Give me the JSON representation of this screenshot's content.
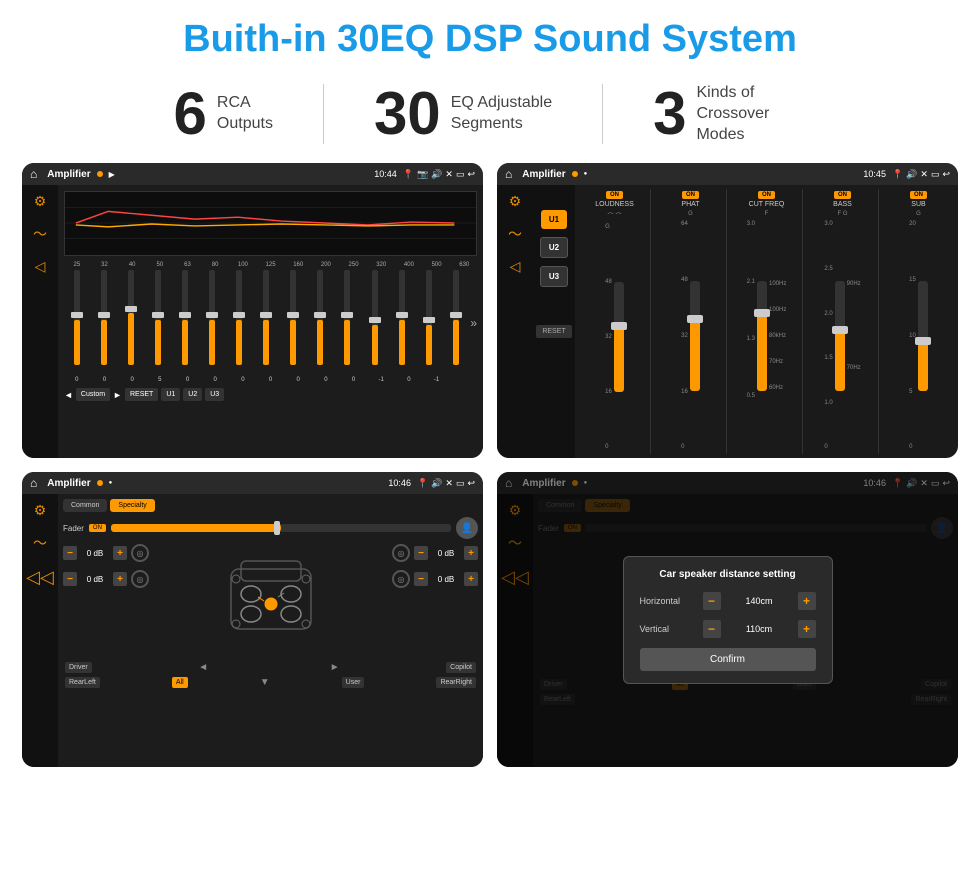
{
  "page": {
    "title": "Buith-in 30EQ DSP Sound System",
    "bg_color": "#ffffff"
  },
  "stats": [
    {
      "number": "6",
      "label": "RCA\nOutputs"
    },
    {
      "number": "30",
      "label": "EQ Adjustable\nSegments"
    },
    {
      "number": "3",
      "label": "Kinds of\nCrossover Modes"
    }
  ],
  "screens": [
    {
      "id": "eq-screen",
      "time": "10:44",
      "title": "Amplifier",
      "description": "EQ Equalizer Screen"
    },
    {
      "id": "amp-screen",
      "time": "10:45",
      "title": "Amplifier",
      "description": "Amplifier Channels Screen"
    },
    {
      "id": "speaker-screen",
      "time": "10:46",
      "title": "Amplifier",
      "description": "Speaker Distance Setup Screen"
    },
    {
      "id": "dialog-screen",
      "time": "10:46",
      "title": "Amplifier",
      "description": "Car Speaker Distance Setting Dialog"
    }
  ],
  "eq": {
    "frequencies": [
      "25",
      "32",
      "40",
      "50",
      "63",
      "80",
      "100",
      "125",
      "160",
      "200",
      "250",
      "320",
      "400",
      "500",
      "630"
    ],
    "values": [
      "0",
      "0",
      "0",
      "5",
      "0",
      "0",
      "0",
      "0",
      "0",
      "0",
      "0",
      "-1",
      "0",
      "-1",
      ""
    ],
    "buttons": [
      "Custom",
      "RESET",
      "U1",
      "U2",
      "U3"
    ]
  },
  "amp": {
    "channels": [
      {
        "label": "LOUDNESS",
        "on": true
      },
      {
        "label": "PHAT",
        "on": true
      },
      {
        "label": "CUT FREQ",
        "on": true
      },
      {
        "label": "BASS",
        "on": true
      },
      {
        "label": "SUB",
        "on": true
      }
    ],
    "u_buttons": [
      "U1",
      "U2",
      "U3"
    ]
  },
  "speaker": {
    "tabs": [
      "Common",
      "Specialty"
    ],
    "fader_label": "Fader",
    "fader_on": true,
    "db_rows": [
      {
        "value": "0 dB"
      },
      {
        "value": "0 dB"
      },
      {
        "value": "0 dB"
      },
      {
        "value": "0 dB"
      }
    ],
    "bottom_labels": [
      "Driver",
      "All",
      "User",
      "Copilot",
      "RearLeft",
      "RearRight"
    ]
  },
  "dialog": {
    "title": "Car speaker distance setting",
    "rows": [
      {
        "label": "Horizontal",
        "value": "140cm"
      },
      {
        "label": "Vertical",
        "value": "110cm"
      }
    ],
    "confirm_label": "Confirm"
  }
}
